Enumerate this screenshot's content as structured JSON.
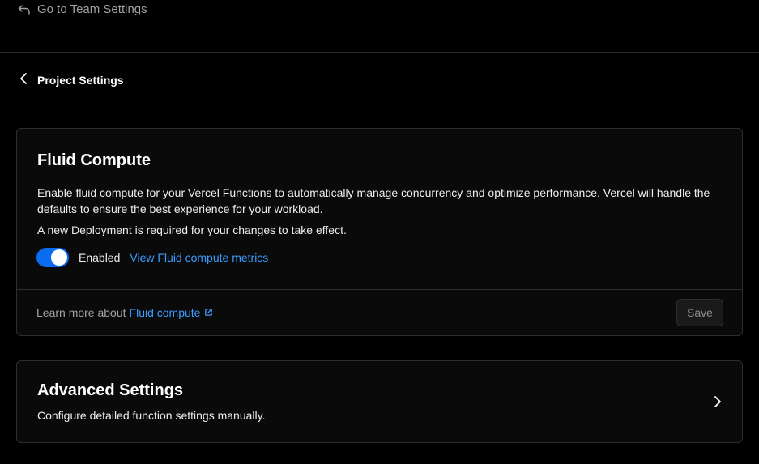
{
  "nav": {
    "back_team_label": "Go to Team Settings",
    "project_title": "Project Settings"
  },
  "fluid": {
    "title": "Fluid Compute",
    "description": "Enable fluid compute for your Vercel Functions to automatically manage concurrency and optimize performance. Vercel will handle the defaults to ensure the best experience for your workload.",
    "note": "A new Deployment is required for your changes to take effect.",
    "toggle_on": true,
    "toggle_label": "Enabled",
    "metrics_link": "View Fluid compute metrics",
    "learn_prefix": "Learn more about",
    "learn_link": "Fluid compute",
    "save_label": "Save"
  },
  "advanced": {
    "title": "Advanced Settings",
    "description": "Configure detailed function settings manually."
  },
  "colors": {
    "background": "#000000",
    "card": "#0a0a0a",
    "accent": "#0a6cf0",
    "link": "#3b9cff"
  },
  "icons": {
    "back_team": "return-arrow-icon",
    "back_project": "chevron-left-icon",
    "external": "external-link-icon",
    "advanced": "chevron-right-icon"
  }
}
